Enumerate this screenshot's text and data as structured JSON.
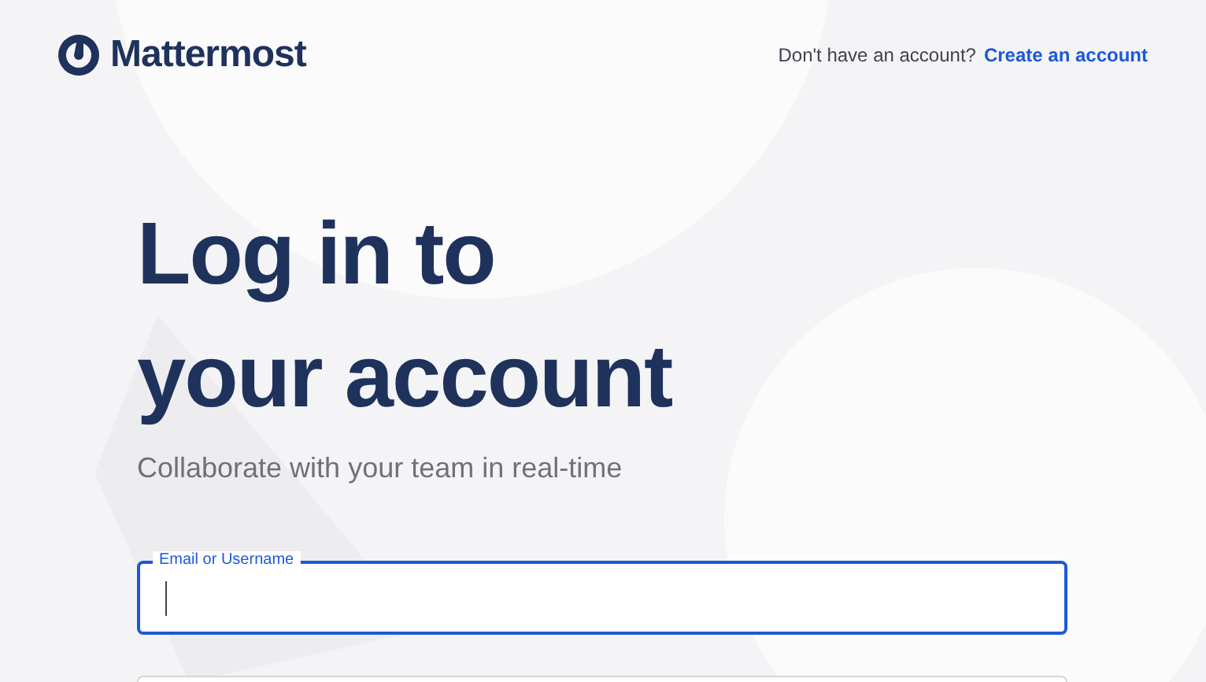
{
  "header": {
    "logo_text": "Mattermost",
    "signup_prompt": "Don't have an account?",
    "signup_link": "Create an account"
  },
  "title_lines": [
    "Log in to",
    "your account"
  ],
  "subtitle": "Collaborate with your team in real-time",
  "fields": [
    {
      "label": "Email or Username",
      "focused": true
    },
    {
      "focused": false
    }
  ]
}
